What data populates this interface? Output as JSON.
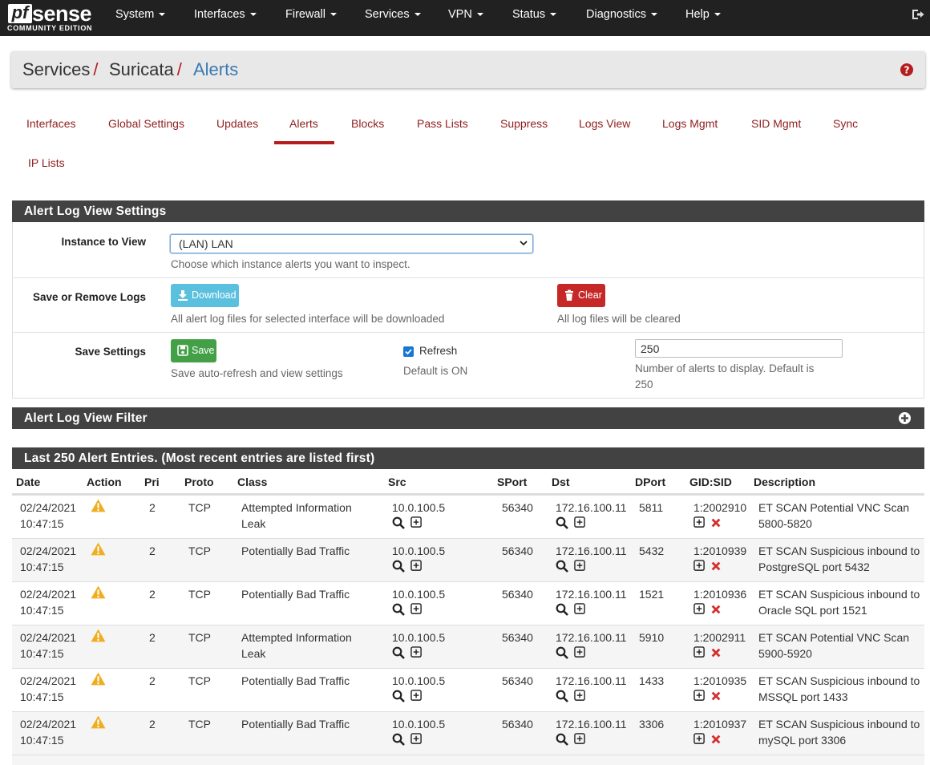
{
  "brand": {
    "logo_pf": "pf",
    "logo_sense": "sense",
    "edition": "COMMUNITY EDITION"
  },
  "nav": [
    "System",
    "Interfaces",
    "Firewall",
    "Services",
    "VPN",
    "Status",
    "Diagnostics",
    "Help"
  ],
  "breadcrumb": [
    "Services",
    "Suricata",
    "Alerts"
  ],
  "tabs": [
    "Interfaces",
    "Global Settings",
    "Updates",
    "Alerts",
    "Blocks",
    "Pass Lists",
    "Suppress",
    "Logs View",
    "Logs Mgmt",
    "SID Mgmt",
    "Sync",
    "IP Lists"
  ],
  "active_tab": "Alerts",
  "settings": {
    "title": "Alert Log View Settings",
    "instance_label": "Instance to View",
    "instance_value": "(LAN) LAN",
    "instance_help": "Choose which instance alerts you want to inspect.",
    "save_remove_label": "Save or Remove Logs",
    "download_label": "Download",
    "download_help": "All alert log files for selected interface will be downloaded",
    "clear_label": "Clear",
    "clear_help": "All log files will be cleared",
    "save_settings_label": "Save Settings",
    "save_label": "Save",
    "save_help": "Save auto-refresh and view settings",
    "refresh_label": "Refresh",
    "refresh_checked": true,
    "refresh_help": "Default is ON",
    "count_value": "250",
    "count_help_1": "Number of alerts to display. Default is",
    "count_help_2": "250"
  },
  "filter": {
    "title": "Alert Log View Filter"
  },
  "alerts": {
    "title": "Last 250 Alert Entries. (Most recent entries are listed first)",
    "columns": [
      "Date",
      "Action",
      "Pri",
      "Proto",
      "Class",
      "Src",
      "SPort",
      "Dst",
      "DPort",
      "GID:SID",
      "Description"
    ],
    "rows": [
      {
        "date": "02/24/2021",
        "time": "10:47:15",
        "pri": "2",
        "proto": "TCP",
        "class1": "Attempted Information",
        "class2": "Leak",
        "src": "10.0.100.5",
        "sport": "56340",
        "dst": "172.16.100.11",
        "dport": "5811",
        "sid": "1:2002910",
        "desc1": "ET SCAN Potential VNC Scan",
        "desc2": "5800-5820"
      },
      {
        "date": "02/24/2021",
        "time": "10:47:15",
        "pri": "2",
        "proto": "TCP",
        "class1": "Potentially Bad Traffic",
        "class2": "",
        "src": "10.0.100.5",
        "sport": "56340",
        "dst": "172.16.100.11",
        "dport": "5432",
        "sid": "1:2010939",
        "desc1": "ET SCAN Suspicious inbound to",
        "desc2": "PostgreSQL port 5432"
      },
      {
        "date": "02/24/2021",
        "time": "10:47:15",
        "pri": "2",
        "proto": "TCP",
        "class1": "Potentially Bad Traffic",
        "class2": "",
        "src": "10.0.100.5",
        "sport": "56340",
        "dst": "172.16.100.11",
        "dport": "1521",
        "sid": "1:2010936",
        "desc1": "ET SCAN Suspicious inbound to",
        "desc2": "Oracle SQL port 1521"
      },
      {
        "date": "02/24/2021",
        "time": "10:47:15",
        "pri": "2",
        "proto": "TCP",
        "class1": "Attempted Information",
        "class2": "Leak",
        "src": "10.0.100.5",
        "sport": "56340",
        "dst": "172.16.100.11",
        "dport": "5910",
        "sid": "1:2002911",
        "desc1": "ET SCAN Potential VNC Scan",
        "desc2": "5900-5920"
      },
      {
        "date": "02/24/2021",
        "time": "10:47:15",
        "pri": "2",
        "proto": "TCP",
        "class1": "Potentially Bad Traffic",
        "class2": "",
        "src": "10.0.100.5",
        "sport": "56340",
        "dst": "172.16.100.11",
        "dport": "1433",
        "sid": "1:2010935",
        "desc1": "ET SCAN Suspicious inbound to",
        "desc2": "MSSQL port 1433"
      },
      {
        "date": "02/24/2021",
        "time": "10:47:15",
        "pri": "2",
        "proto": "TCP",
        "class1": "Potentially Bad Traffic",
        "class2": "",
        "src": "10.0.100.5",
        "sport": "56340",
        "dst": "172.16.100.11",
        "dport": "3306",
        "sid": "1:2010937",
        "desc1": "ET SCAN Suspicious inbound to",
        "desc2": "mySQL port 3306"
      }
    ]
  },
  "icons": {
    "action": "warning-icon",
    "lookup": "search-icon",
    "add": "plus-square-icon",
    "remove": "red-x-icon"
  },
  "colors": {
    "navbar": "#212121",
    "panel_head": "#424242",
    "accent_red": "#b71c1c",
    "tab_text": "#8f1d1d",
    "crumb_active": "#3a7ab0"
  }
}
